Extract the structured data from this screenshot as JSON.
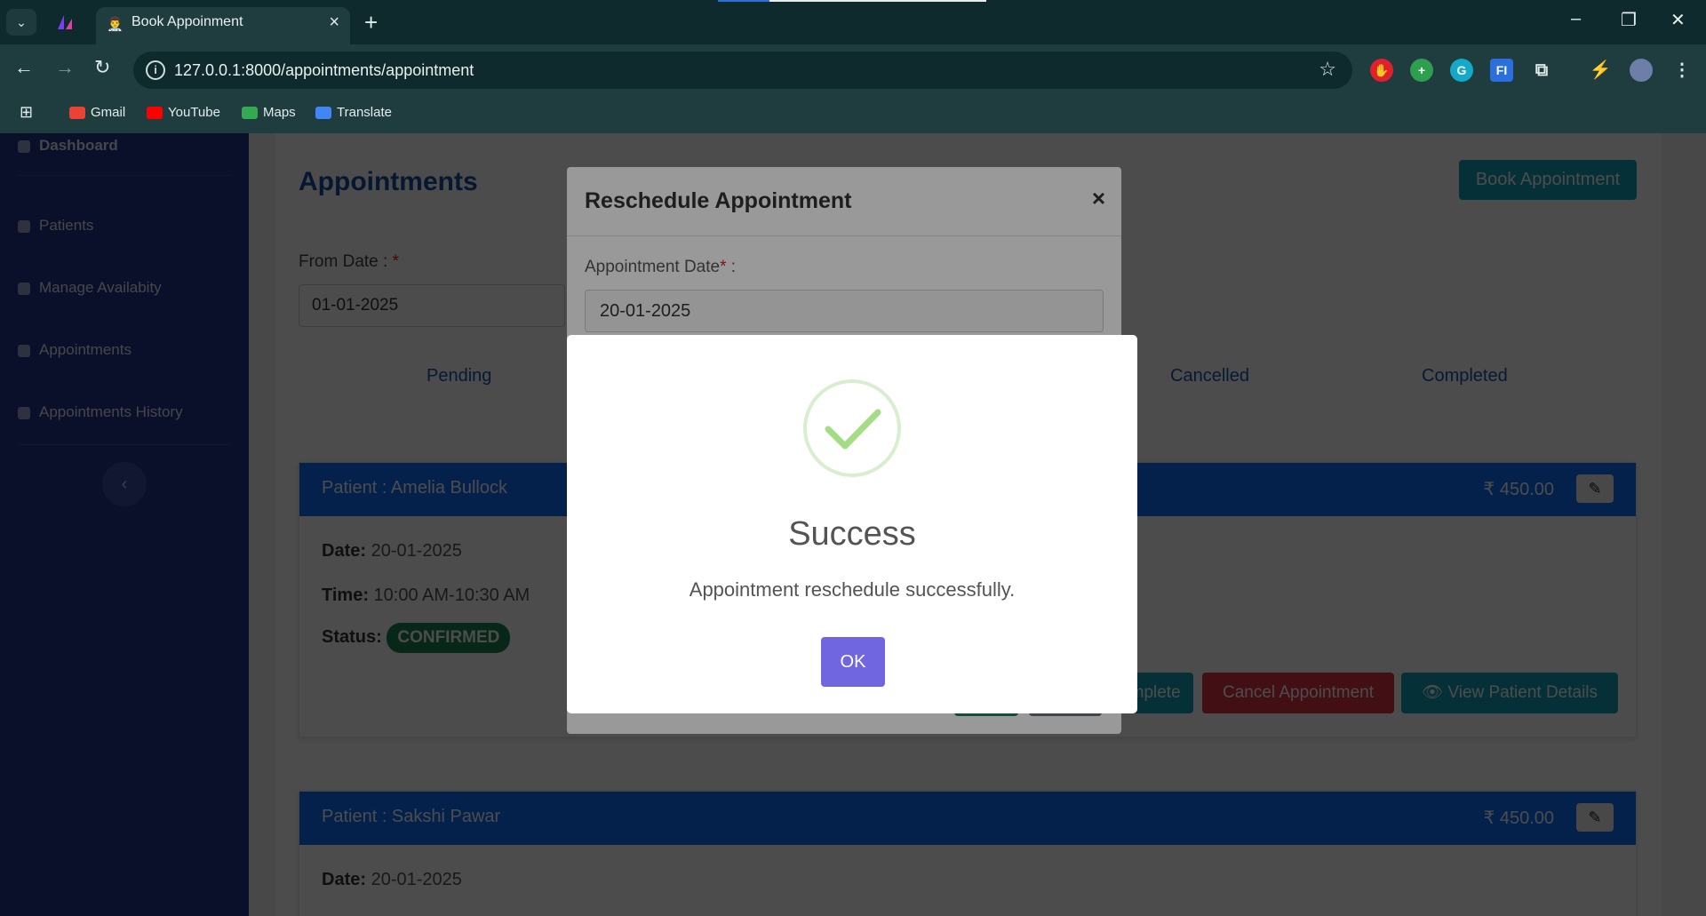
{
  "browser": {
    "tab_title": "Book Appoinment",
    "tab_close": "×",
    "new_tab": "+",
    "url": "127.0.0.1:8000/appointments/appointment",
    "bookmarks": [
      "Gmail",
      "YouTube",
      "Maps",
      "Translate"
    ],
    "minimize": "–",
    "restore": "❐",
    "close": "✕"
  },
  "sidebar": {
    "items": [
      "Dashboard",
      "Patients",
      "Manage Availabity",
      "Appointments",
      "Appointments History"
    ],
    "collapse": "‹"
  },
  "page": {
    "title": "Appointments",
    "book_button": "Book Appointment",
    "from_label": "From Date :",
    "required": "*",
    "from_value": "01-01-2025",
    "tabs": [
      "Pending",
      "Cancelled",
      "Completed"
    ]
  },
  "cards": [
    {
      "patient": "Patient : Amelia Bullock",
      "fee": "₹ 450.00",
      "date_label": "Date:",
      "date": "20-01-2025",
      "time_label": "Time:",
      "time": "10:00 AM-10:30 AM",
      "status_label": "Status:",
      "status": "CONFIRMED",
      "actions": [
        "Complete",
        "Cancel Appointment",
        "View Patient Details"
      ]
    },
    {
      "patient": "Patient : Sakshi Pawar",
      "fee": "₹ 450.00",
      "date_label": "Date:",
      "date": "20-01-2025"
    }
  ],
  "reschedule_modal": {
    "title": "Reschedule Appointment",
    "close": "×",
    "date_label": "Appointment Date",
    "required": "*",
    "label_suffix": " :",
    "date_value": "20-01-2025"
  },
  "success_dialog": {
    "title": "Success",
    "message": "Appointment reschedule successfully.",
    "ok": "OK"
  },
  "colors": {
    "sidebar": "#22358f",
    "card_header": "#0d6efd",
    "confirm_button": "#7066e0",
    "book_button": "#17a2b8",
    "cancel_button": "#dc3545",
    "status_confirmed": "#198754"
  }
}
